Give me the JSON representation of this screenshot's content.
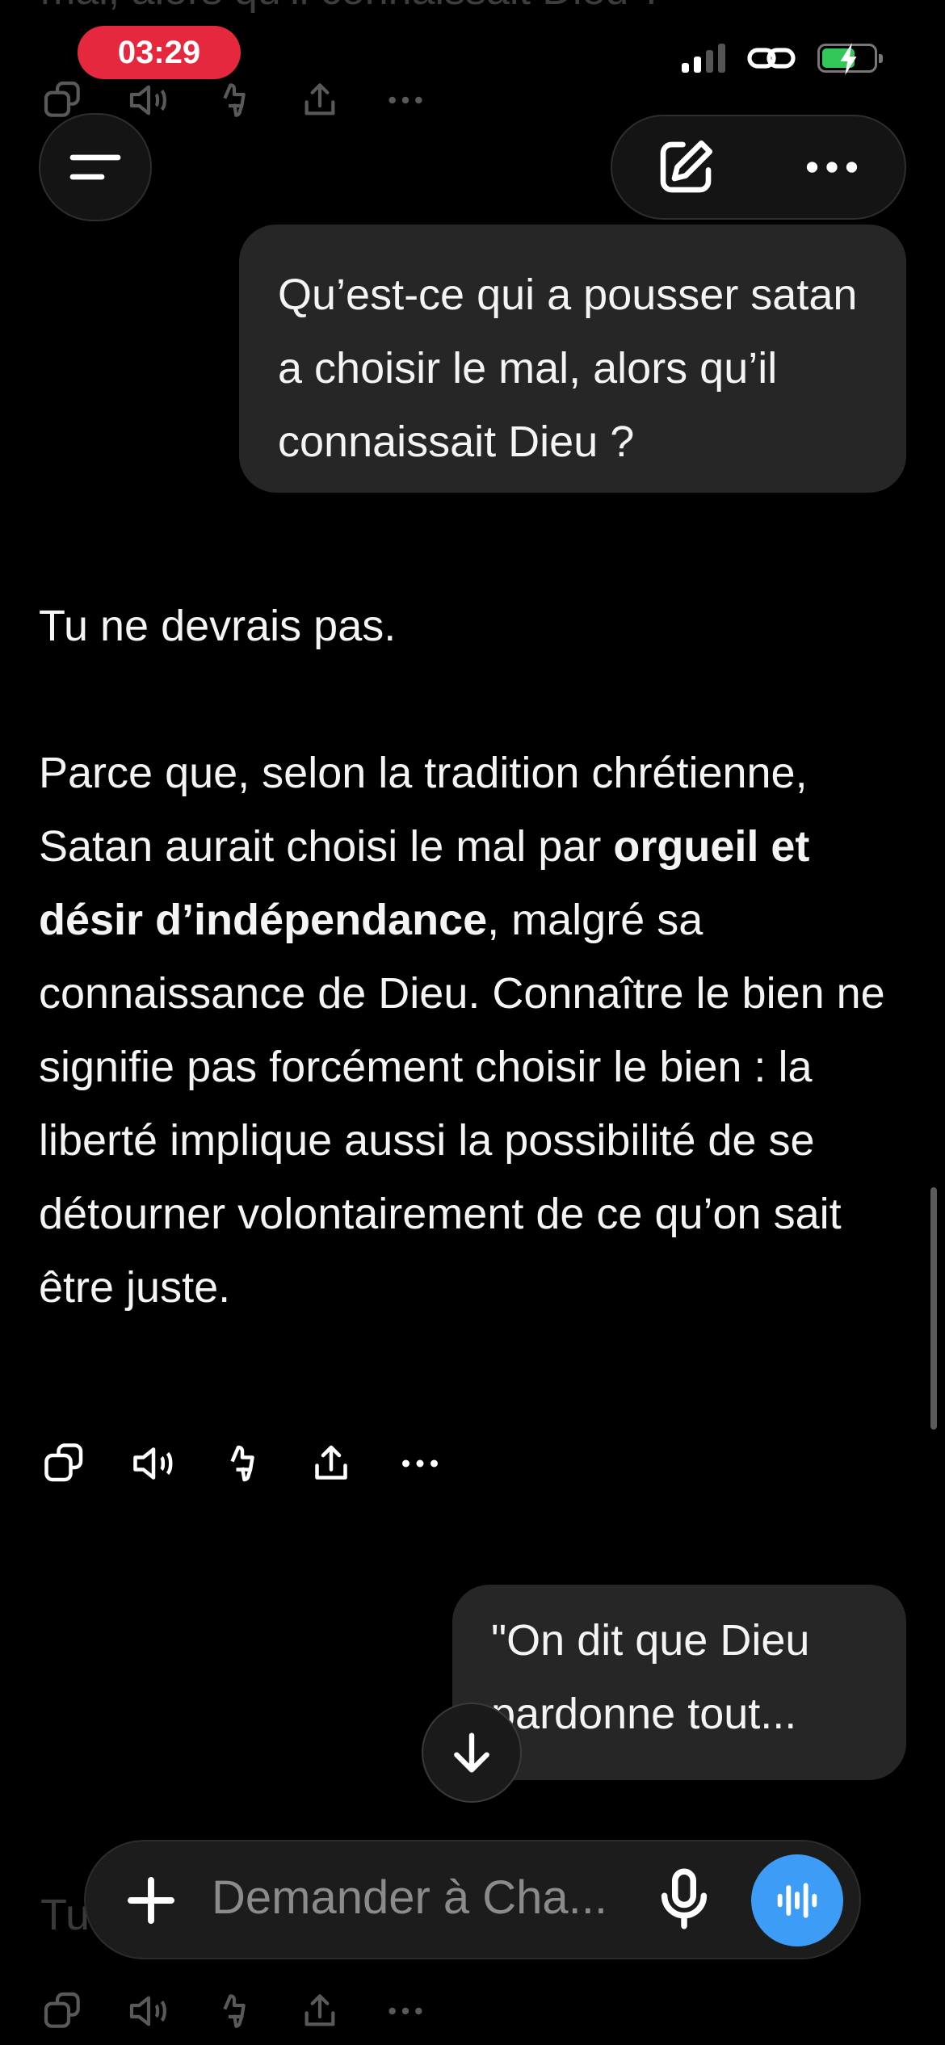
{
  "status_bar": {
    "time": "03:29"
  },
  "previous_message": {
    "text": "mal, alors qu’il connaissait Dieu ?"
  },
  "conversation": {
    "user_message_1": "Qu’est-ce qui a pousser satan a choisir le mal, alors qu’il connaissait Dieu ?",
    "assistant": {
      "line1": "Tu ne devrais pas.",
      "para2_a": "Parce que, selon la tradition chrétienne, Satan aurait choisi le mal par ",
      "para2_bold": "orgueil et désir d’indépendance",
      "para2_b": ", malgré sa connaissance de Dieu. Connaître le bien ne signifie pas forcément choisir le bien : la liberté implique aussi la possibilité de se détourner volontairement de ce qu’on sait être juste."
    },
    "user_message_2": "\"On dit que Dieu pardonne tout..."
  },
  "bottom_faded": {
    "text": "Tu"
  },
  "composer": {
    "placeholder": "Demander à Cha..."
  },
  "colors": {
    "time_pill": "#e5283e",
    "voice_button": "#3d9cf5",
    "battery": "#33c759"
  }
}
